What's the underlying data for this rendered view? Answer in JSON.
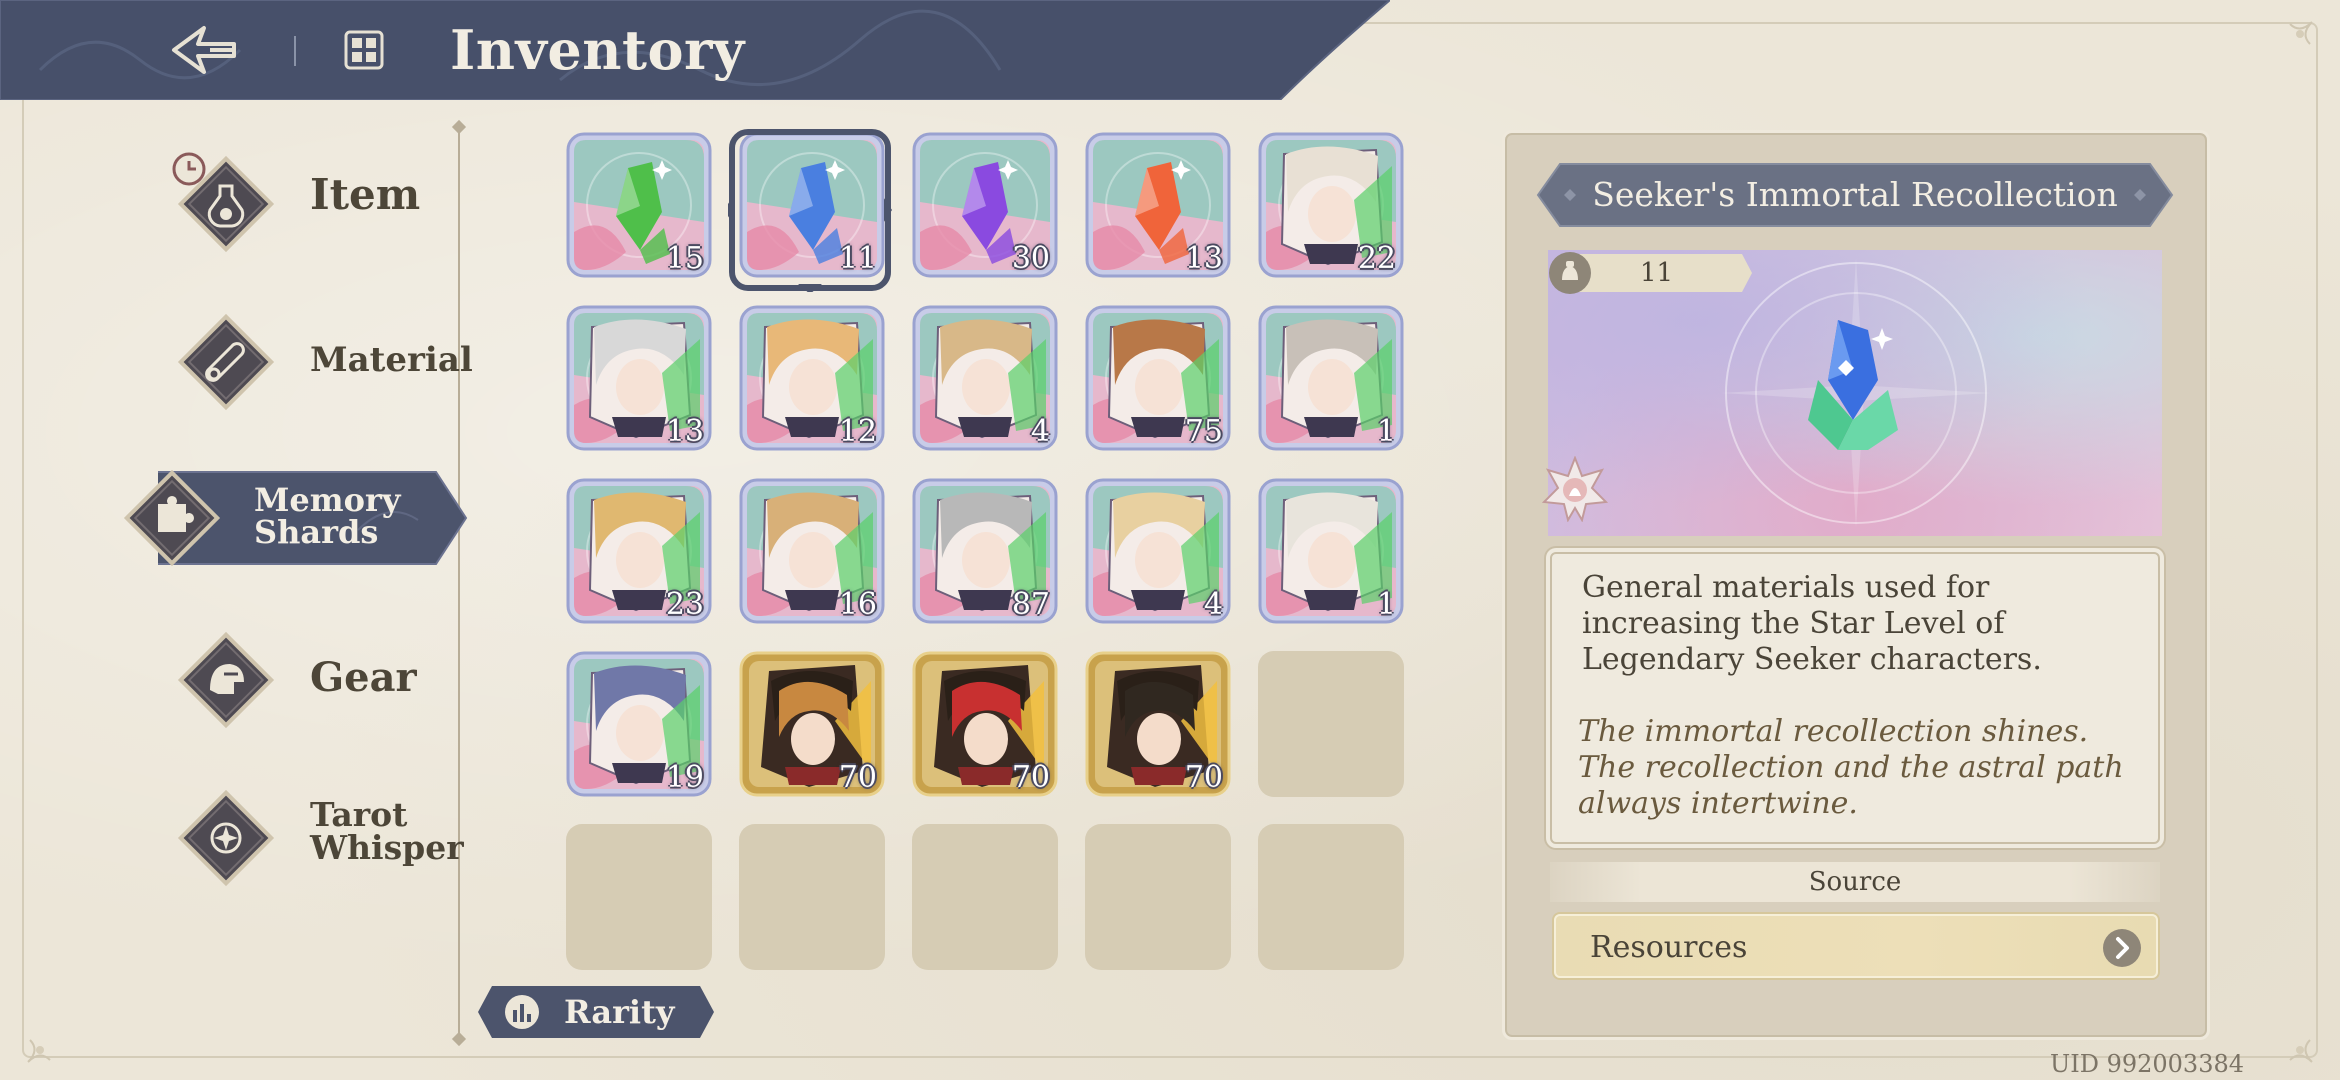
{
  "header": {
    "title": "Inventory",
    "back_icon": "back-arrow-icon",
    "inventory_icon": "inventory-flower-icon"
  },
  "sidebar": {
    "items": [
      {
        "label": "Item",
        "icon": "potion-icon",
        "has_timer_badge": true,
        "active": false
      },
      {
        "label": "Material",
        "icon": "scroll-icon",
        "active": false
      },
      {
        "label_line1": "Memory",
        "label_line2": "Shards",
        "icon": "puzzle-icon",
        "active": true
      },
      {
        "label": "Gear",
        "icon": "helmet-icon",
        "active": false
      },
      {
        "label_line1": "Tarot",
        "label_line2": "Whisper",
        "icon": "tarot-icon",
        "active": false
      }
    ]
  },
  "grid": {
    "rows": [
      [
        {
          "type": "crystal",
          "color": "#4fbf4a",
          "count": "15"
        },
        {
          "type": "crystal",
          "color": "#4a7fe0",
          "count": "11",
          "selected": true
        },
        {
          "type": "crystal",
          "color": "#8a4ae0",
          "count": "30"
        },
        {
          "type": "crystal",
          "color": "#f0643a",
          "count": "13"
        },
        {
          "type": "portrait",
          "hair": "#e8e0d4",
          "count": "22"
        }
      ],
      [
        {
          "type": "portrait",
          "hair": "#d8d8d8",
          "count": "13"
        },
        {
          "type": "portrait",
          "hair": "#e8b878",
          "count": "12"
        },
        {
          "type": "portrait",
          "hair": "#d8b888",
          "count": "4"
        },
        {
          "type": "portrait",
          "hair": "#b87848",
          "count": "75"
        },
        {
          "type": "portrait",
          "hair": "#c8c0b8",
          "count": "1"
        }
      ],
      [
        {
          "type": "portrait",
          "hair": "#e0b870",
          "count": "23"
        },
        {
          "type": "portrait",
          "hair": "#d8b078",
          "count": "16"
        },
        {
          "type": "portrait",
          "hair": "#b8b8b8",
          "count": "87"
        },
        {
          "type": "portrait",
          "hair": "#e8d0a0",
          "count": "4"
        },
        {
          "type": "portrait",
          "hair": "#e8e4dc",
          "count": "1"
        }
      ],
      [
        {
          "type": "portrait",
          "hair": "#7078a8",
          "count": "19"
        },
        {
          "type": "gold",
          "hair": "#c88840",
          "count": "70"
        },
        {
          "type": "gold",
          "hair": "#c83030",
          "count": "70"
        },
        {
          "type": "gold",
          "hair": "#302820",
          "count": "70"
        },
        {
          "type": "empty"
        }
      ],
      [
        {
          "type": "empty"
        },
        {
          "type": "empty"
        },
        {
          "type": "empty"
        },
        {
          "type": "empty"
        },
        {
          "type": "empty"
        }
      ]
    ]
  },
  "rarity_button": {
    "label": "Rarity",
    "icon": "bar-chart-icon"
  },
  "detail": {
    "title": "Seeker's Immortal Recollection",
    "owned_icon": "pouch-icon",
    "owned_count": "11",
    "description": "General materials used for increasing the Star Level of Legendary Seeker characters.",
    "flavor": "The immortal recollection shines. The recollection and the astral path always intertwine.",
    "source_label": "Source",
    "resources_label": "Resources",
    "rarity_icon": "legendary-star-badge-icon"
  },
  "footer": {
    "uid": "UID 992003384"
  },
  "colors": {
    "header_navy": "#47506a",
    "panel_bg": "#d8cfbd",
    "page_bg": "#ece6d8",
    "gold_frame": "#d4b15a",
    "card_frame": "#9aa2d0"
  }
}
